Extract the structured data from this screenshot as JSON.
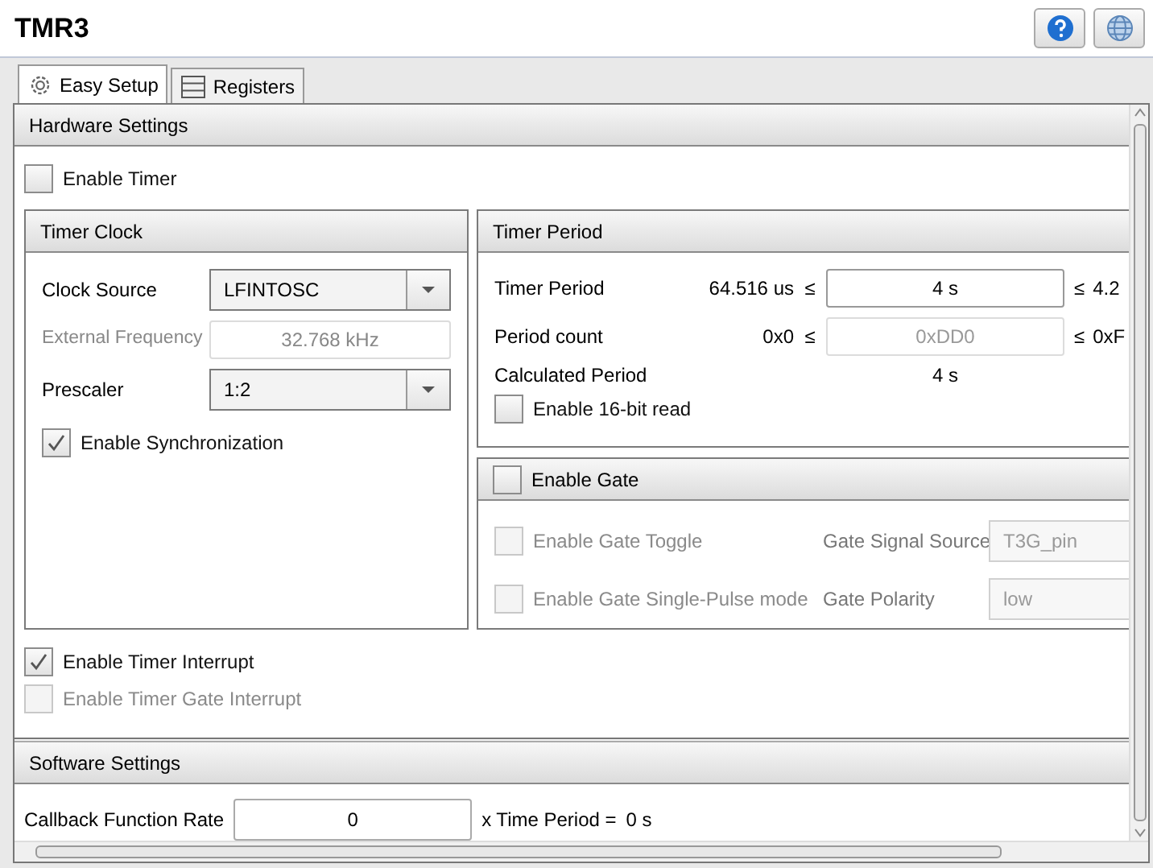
{
  "title": "TMR3",
  "tabs": [
    {
      "label": "Easy Setup",
      "kind": "gear",
      "selected": true
    },
    {
      "label": "Registers",
      "kind": "registers",
      "selected": false
    }
  ],
  "hardware": {
    "title": "Hardware Settings",
    "enable_timer": {
      "label": "Enable Timer",
      "checked": false
    },
    "timer_clock": {
      "title": "Timer Clock",
      "clock_source": {
        "label": "Clock Source",
        "value": "LFINTOSC"
      },
      "external_frequency": {
        "label": "External Frequency",
        "value": "32.768 kHz",
        "disabled": true
      },
      "prescaler": {
        "label": "Prescaler",
        "value": "1:2"
      },
      "synchronization": {
        "label": "Enable Synchronization",
        "checked": true
      }
    },
    "timer_period": {
      "title": "Timer Period",
      "rows": [
        {
          "label": "Timer Period",
          "min": "64.516 us",
          "le": "≤",
          "value": "4 s",
          "max_le": "≤",
          "max": "4.2",
          "disabled": false
        },
        {
          "label": "Period count",
          "min": "0x0",
          "le": "≤",
          "value": "0xDD0",
          "max_le": "≤",
          "max": "0xF",
          "disabled": true
        }
      ],
      "calculated": {
        "label": "Calculated Period",
        "value": "4 s"
      },
      "read16": {
        "label": "Enable 16-bit read",
        "checked": false
      }
    },
    "gate": {
      "label": "Enable Gate",
      "checked": false,
      "toggle": {
        "label": "Enable Gate Toggle",
        "checked": false,
        "disabled": true
      },
      "single_pulse": {
        "label": "Enable Gate Single-Pulse mode",
        "checked": false,
        "disabled": true
      },
      "signal_source": {
        "label": "Gate Signal Source",
        "value": "T3G_pin",
        "disabled": true
      },
      "polarity": {
        "label": "Gate Polarity",
        "value": "low",
        "disabled": true
      }
    },
    "timer_interrupt": {
      "label": "Enable Timer Interrupt",
      "checked": true,
      "disabled": false
    },
    "gate_interrupt": {
      "label": "Enable Timer Gate Interrupt",
      "checked": false,
      "disabled": true
    }
  },
  "software": {
    "title": "Software Settings",
    "callback": {
      "label": "Callback Function Rate",
      "value": "0",
      "suffix": "x Time Period =",
      "result": "0 s"
    }
  }
}
